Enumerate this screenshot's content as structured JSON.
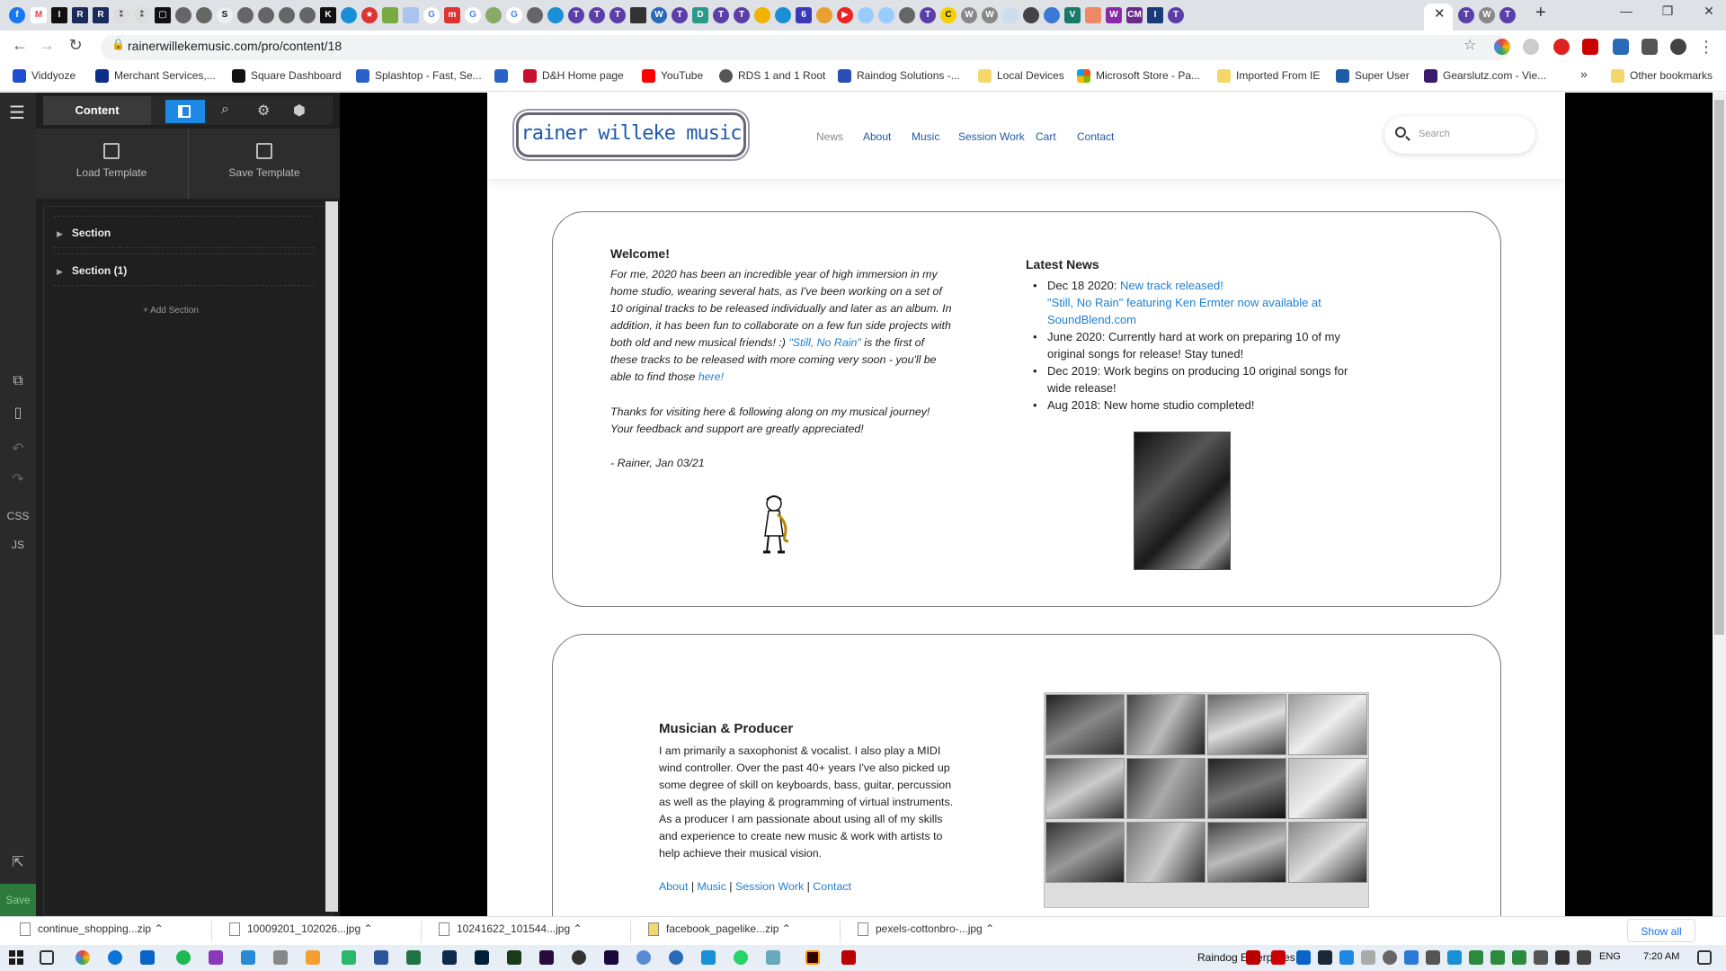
{
  "browser": {
    "url": "rainerwillekemusic.com/pro/content/18",
    "bookmarks": [
      {
        "label": "Viddyoze",
        "color": "#1e4fd0"
      },
      {
        "label": "Merchant Services,...",
        "color": "#0a2e8a"
      },
      {
        "label": "Square Dashboard",
        "color": "#111111"
      },
      {
        "label": "Splashtop - Fast, Se...",
        "color": "#2a63c8"
      },
      {
        "label": "",
        "color": "#2a63c8"
      },
      {
        "label": "D&H Home page",
        "color": "#c8102e"
      },
      {
        "label": "YouTube",
        "color": "#ff0000"
      },
      {
        "label": "RDS 1 and 1 Root",
        "color": "#555555"
      },
      {
        "label": "Raindog Solutions -...",
        "color": "#2b4fb8"
      },
      {
        "label": "Local Devices",
        "color": "#f4d76b"
      },
      {
        "label": "Microsoft Store - Pa...",
        "color": "#f25022"
      },
      {
        "label": "Imported From IE",
        "color": "#f4d76b"
      },
      {
        "label": "Super User",
        "color": "#1e5aa8"
      },
      {
        "label": "Gearslutz.com - Vie...",
        "color": "#3a1a6a"
      },
      {
        "label": "Other bookmarks",
        "color": "#f4d76b"
      }
    ],
    "bookmarks_overflow": "»",
    "downloads": [
      {
        "name": "continue_shopping...zip"
      },
      {
        "name": "10009201_102026...jpg"
      },
      {
        "name": "10241622_101544...jpg"
      },
      {
        "name": "facebook_pagelike...zip"
      },
      {
        "name": "pexels-cottonbro-...jpg"
      }
    ],
    "show_all_label": "Show all"
  },
  "editor": {
    "tab_content_label": "Content",
    "load_template_label": "Load Template",
    "save_template_label": "Save Template",
    "tree": [
      {
        "label": "Section"
      },
      {
        "label": "Section (1)"
      }
    ],
    "add_section_label": "+ Add Section",
    "rail_css_label": "CSS",
    "rail_js_label": "JS",
    "rail_save_label": "Save"
  },
  "site": {
    "logo_text": "rainer willeke music",
    "nav": [
      "News",
      "About",
      "Music",
      "Session Work",
      "Cart",
      "Contact"
    ],
    "search_placeholder": "Search",
    "welcome": {
      "title": "Welcome!",
      "p1_a": "For me, 2020 has been an incredible year of high immersion in my home studio, wearing several hats, as I've been working on a set of 10 original tracks to be released individually and later as an album.  In addition, it has been fun to collaborate on a few fun side projects with both old and new musical friends! :) ",
      "p1_link": "\"Still, No Rain\"",
      "p1_b": " is the first of these tracks to be released with more coming very soon - you'll be able to find those ",
      "p1_link2": "here!",
      "p2": "Thanks for visiting here & following along on my musical journey! Your feedback and support are greatly appreciated!",
      "signature": "- Rainer, Jan 03/21"
    },
    "news": {
      "title": "Latest News",
      "item1_date": "Dec 18 2020: ",
      "item1_link": "New track released!",
      "item1_link2": "\"Still, No Rain\" featuring Ken Ermter now available at SoundBlend.com",
      "item2": "June 2020: Currently hard at work on preparing 10 of my original songs for release! Stay tuned!",
      "item3": "Dec 2019: Work begins on producing 10 original songs for wide release!",
      "item4": "Aug 2018: New home studio completed!"
    },
    "musician": {
      "title": "Musician & Producer",
      "text": "I am primarily a saxophonist & vocalist.  I also play a MIDI wind controller.  Over the past 40+ years I've also picked up some degree of skill on keyboards, bass, guitar, percussion as well as the playing & programming of virtual instruments.  As a producer I am passionate about using all of my skills and experience to create new music & work with artists to help achieve their musical vision.",
      "links": [
        "About",
        "Music",
        "Session Work",
        "Contact"
      ]
    }
  },
  "taskbar": {
    "user_label": "Raindog Enterprises",
    "lang": "ENG",
    "clock": "7:20 AM"
  },
  "colors": {
    "accent_blue": "#1e5aa8",
    "link_blue": "#1e7fd1",
    "editor_dark": "#1f1f1f",
    "editor_active_tab": "#1e88e5",
    "save_green": "#2c7a3c"
  }
}
